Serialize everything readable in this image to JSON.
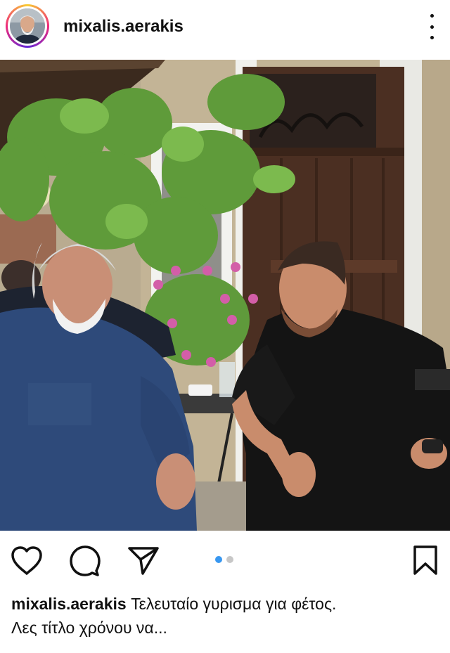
{
  "post": {
    "username": "mixalis.aerakis",
    "caption_user": "mixalis.aerakis",
    "caption_text": "Τελευταίο γυρισμα για φέτος.",
    "caption_line2": "Λες τίτλο χρόνου να...",
    "carousel": {
      "count": 2,
      "active_index": 0
    }
  },
  "icons": {
    "more": "more-vertical-icon",
    "like": "heart-icon",
    "comment": "comment-icon",
    "share": "paper-plane-icon",
    "save": "bookmark-icon"
  },
  "colors": {
    "accent": "#3897f0",
    "inactive_dot": "#c7c7c7",
    "text": "#111111"
  }
}
